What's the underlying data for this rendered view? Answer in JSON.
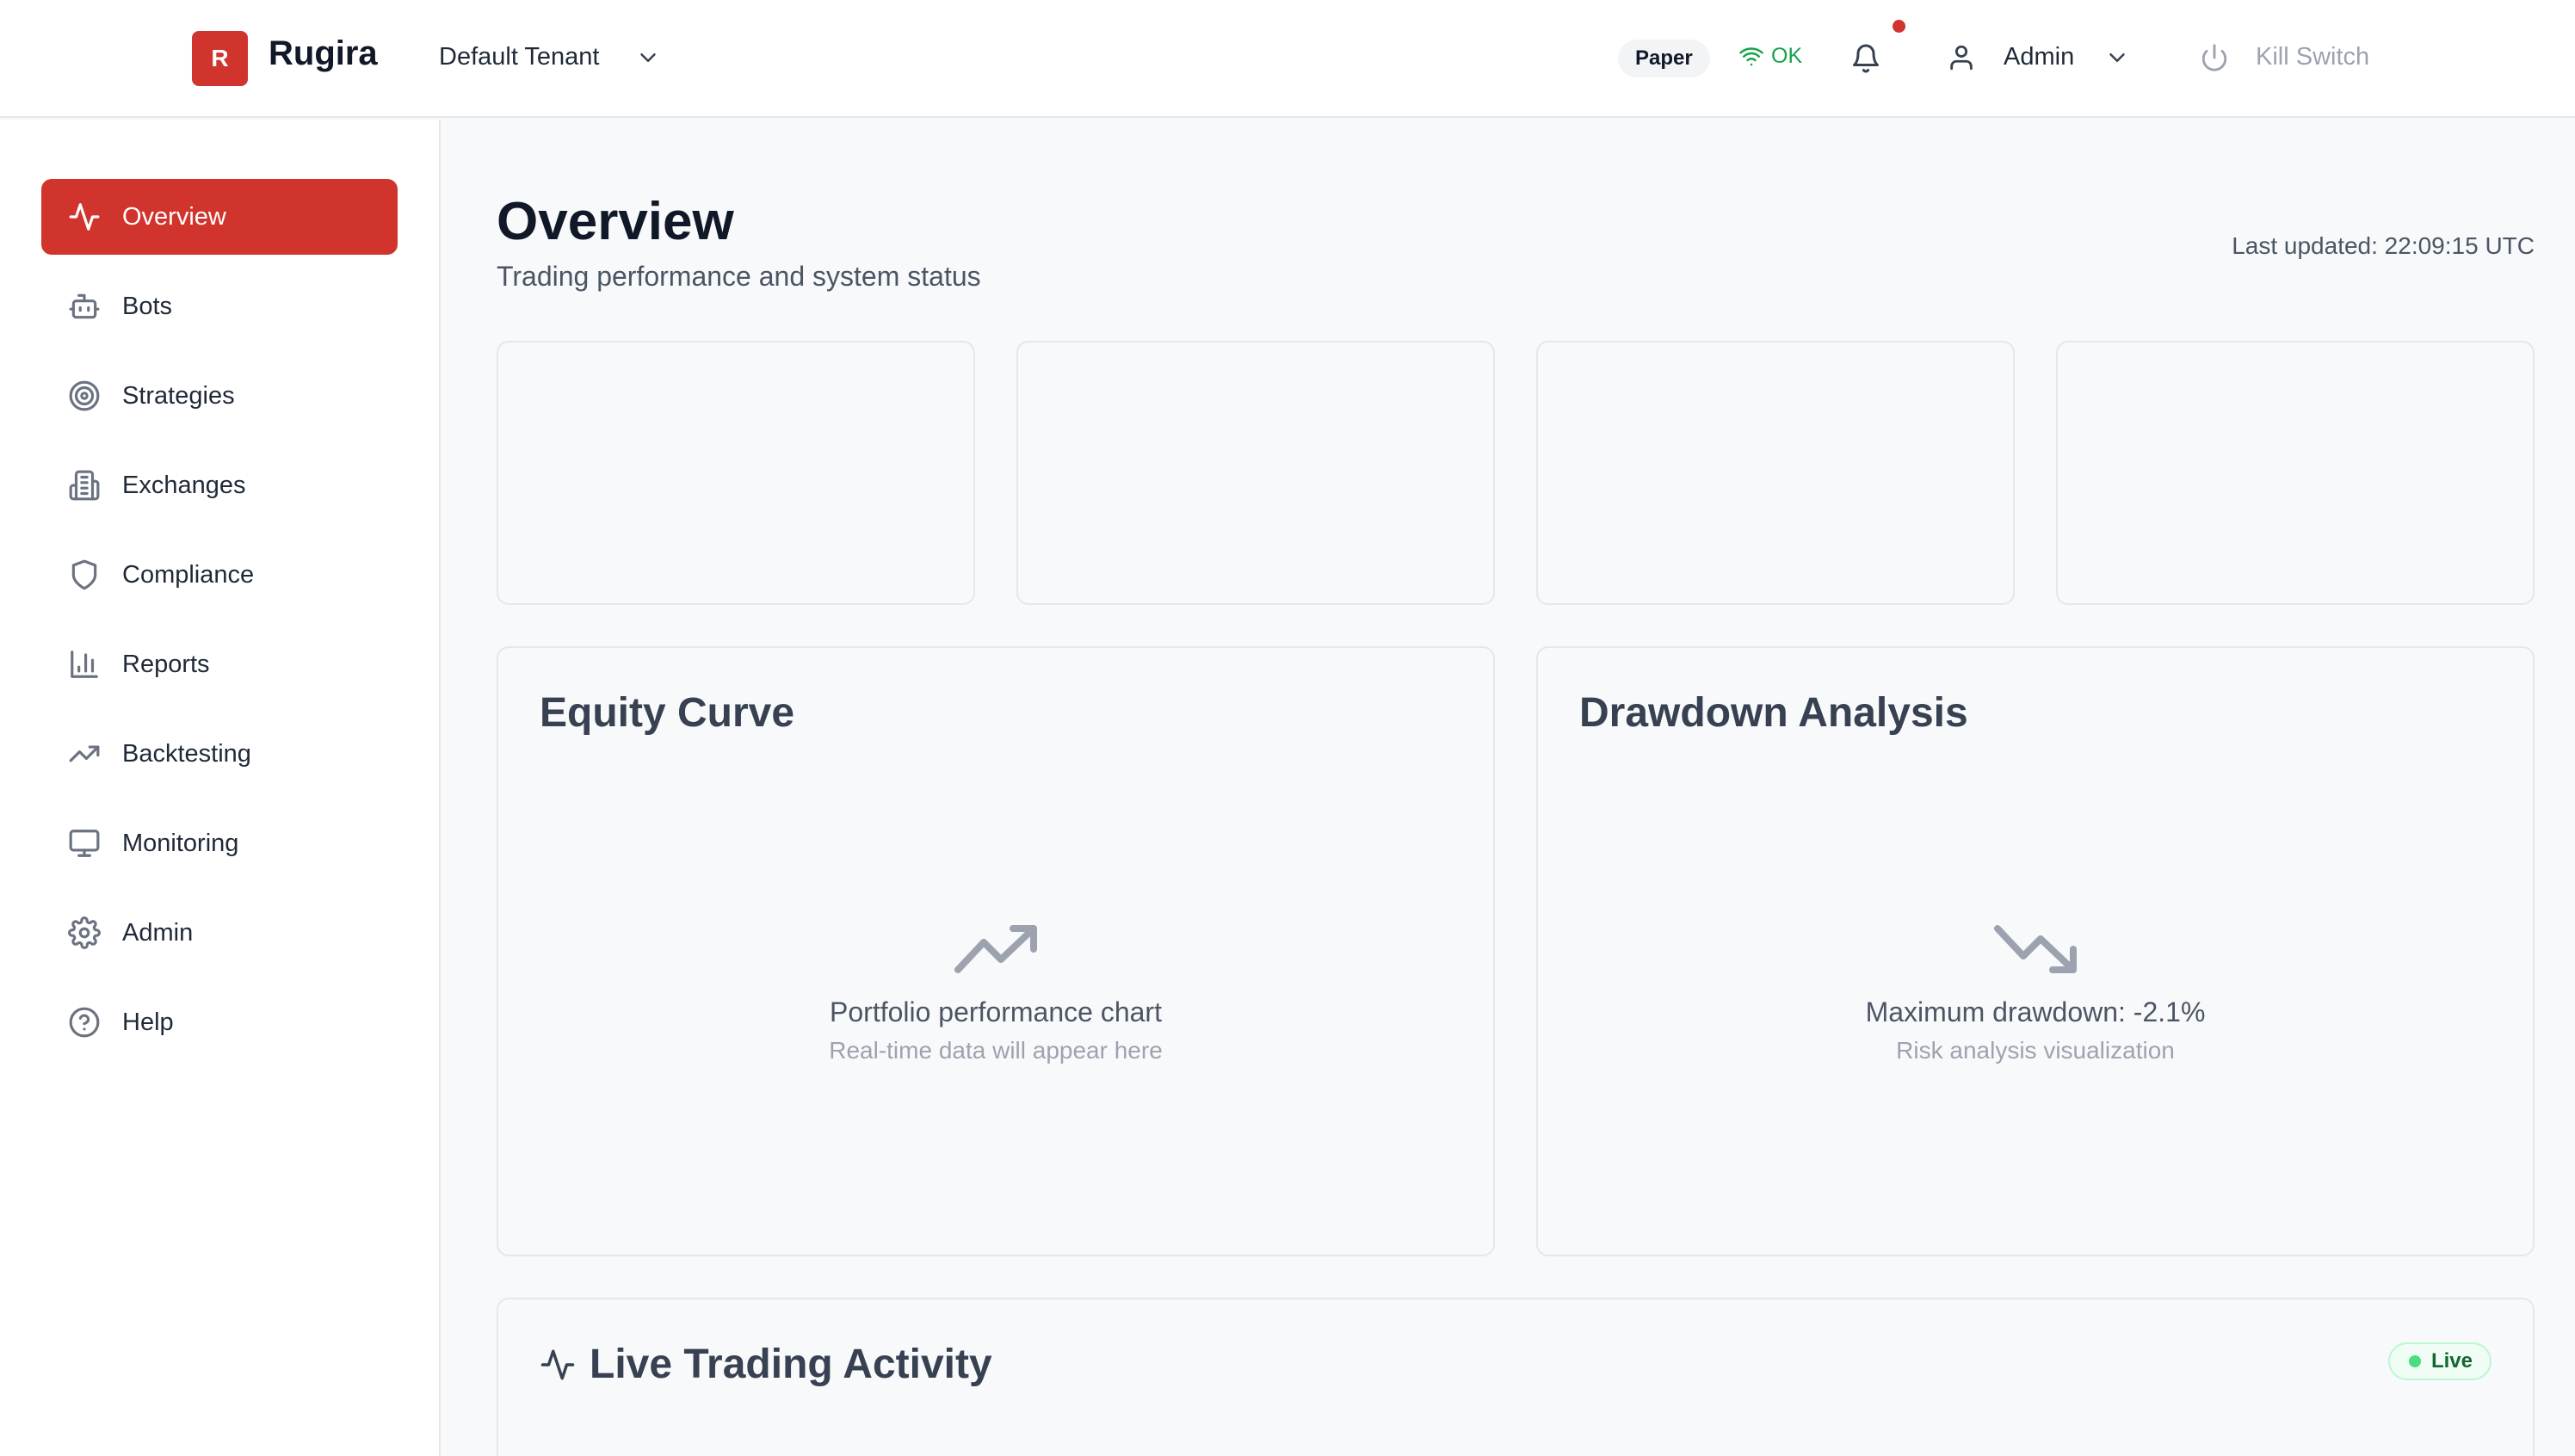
{
  "header": {
    "logo_letter": "R",
    "brand": "Rugira",
    "tenant": "Default Tenant",
    "mode_badge": "Paper",
    "connection_status": "OK",
    "user_name": "Admin",
    "kill_switch_label": "Kill Switch"
  },
  "sidebar": {
    "items": [
      {
        "label": "Overview",
        "icon": "activity-icon",
        "active": true
      },
      {
        "label": "Bots",
        "icon": "bot-icon"
      },
      {
        "label": "Strategies",
        "icon": "target-icon"
      },
      {
        "label": "Exchanges",
        "icon": "building-icon"
      },
      {
        "label": "Compliance",
        "icon": "shield-icon"
      },
      {
        "label": "Reports",
        "icon": "bar-chart-icon"
      },
      {
        "label": "Backtesting",
        "icon": "trending-up-icon"
      },
      {
        "label": "Monitoring",
        "icon": "monitor-icon"
      },
      {
        "label": "Admin",
        "icon": "gear-icon"
      },
      {
        "label": "Help",
        "icon": "help-circle-icon"
      }
    ]
  },
  "main": {
    "title": "Overview",
    "subtitle": "Trading performance and system status",
    "last_updated": "Last updated: 22:09:15 UTC",
    "equity": {
      "title": "Equity Curve",
      "message": "Portfolio performance chart",
      "sub": "Real-time data will appear here"
    },
    "drawdown": {
      "title": "Drawdown Analysis",
      "message": "Maximum drawdown: -2.1%",
      "sub": "Risk analysis visualization"
    },
    "activity": {
      "title": "Live Trading Activity",
      "badge": "Live"
    }
  },
  "colors": {
    "accent": "#d0342c",
    "success": "#16a34a"
  }
}
